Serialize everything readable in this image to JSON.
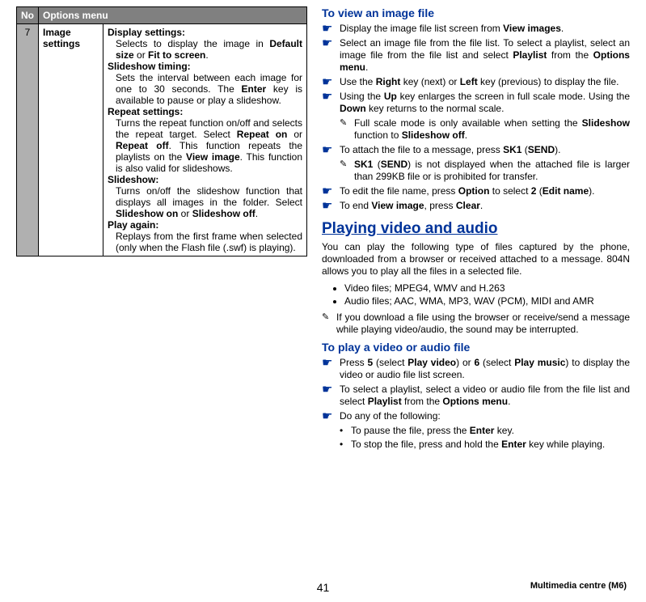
{
  "table": {
    "headers": {
      "no": "No",
      "menu": "Options menu"
    },
    "row": {
      "num": "7",
      "label": "Image settings",
      "blocks": [
        {
          "title": "Display settings:",
          "html": "Selects to display the image in <b>Default size</b> or <b>Fit to screen</b>."
        },
        {
          "title": "Slideshow timing:",
          "html": "Sets the interval between each image for one to 30 seconds. The <b>Enter</b> key is available to pause or play a slideshow."
        },
        {
          "title": "Repeat settings:",
          "html": "Turns the repeat function on/off and selects the repeat target. Select <b>Repeat on</b> or <b>Repeat off</b>. This function repeats the playlists on the <b>View image</b>. This function is also valid for slideshows."
        },
        {
          "title": "Slideshow:",
          "html": "Turns on/off the slideshow function that displays all images in the folder. Select <b>Slideshow on</b> or <b>Slideshow off</b>."
        },
        {
          "title": "Play again:",
          "html": "Replays from the first frame when selected (only when the Flash file (.swf) is playing)."
        }
      ]
    }
  },
  "view": {
    "title": "To view an image file",
    "items": [
      {
        "html": "Display the image file list screen from <b>View images</b>."
      },
      {
        "html": "Select an image file from the file list. To select a playlist, select an image file from the file list and select <b>Playlist</b> from the <b>Options menu</b>."
      },
      {
        "html": "Use the <b>Right</b> key (next) or <b>Left</b> key (previous) to display the file."
      },
      {
        "html": "Using the <b>Up</b> key enlarges the screen in full scale mode. Using the <b>Down</b> key returns to the normal scale.",
        "sub": {
          "html": "Full scale mode is only available when setting the <b>Slideshow</b> function to <b>Slideshow off</b>."
        }
      },
      {
        "html": "To attach the file to a message, press <b>SK1</b> (<b>SEND</b>).",
        "sub": {
          "html": "<b>SK1</b> (<b>SEND</b>) is not displayed when the attached file is larger than 299KB file or is prohibited for transfer."
        }
      },
      {
        "html": "To edit the file name, press <b>Option</b> to select <b>2</b> (<b>Edit name</b>)."
      },
      {
        "html": "To end <b>View image</b>, press <b>Clear</b>."
      }
    ]
  },
  "playing": {
    "heading": "Playing video and audio",
    "intro": "You can play the following type of files captured by the phone, downloaded from a browser or received attached to a message. 804N allows you to play all the files in a selected file.",
    "bullets": [
      "Video files; MPEG4, WMV and H.263",
      "Audio files; AAC, WMA, MP3, WAV (PCM), MIDI and AMR"
    ],
    "note": "If you download a file using the browser or receive/send a message while playing video/audio, the sound may be interrupted."
  },
  "play": {
    "title": "To play a video or audio file",
    "items": [
      {
        "html": "Press <b>5</b> (select <b>Play video</b>) or <b>6</b> (select <b>Play music</b>) to display the video or audio file list screen."
      },
      {
        "html": "To select a playlist, select a video or audio file from the file list and select <b>Playlist</b> from the <b>Options menu</b>."
      },
      {
        "html": "Do any of the following:",
        "dots": [
          {
            "html": "To pause the file, press the <b>Enter</b> key."
          },
          {
            "html": "To stop the file, press and hold the <b>Enter</b> key while playing."
          }
        ]
      }
    ]
  },
  "footer": {
    "page": "41",
    "chapter": "Multimedia centre (M6)"
  }
}
